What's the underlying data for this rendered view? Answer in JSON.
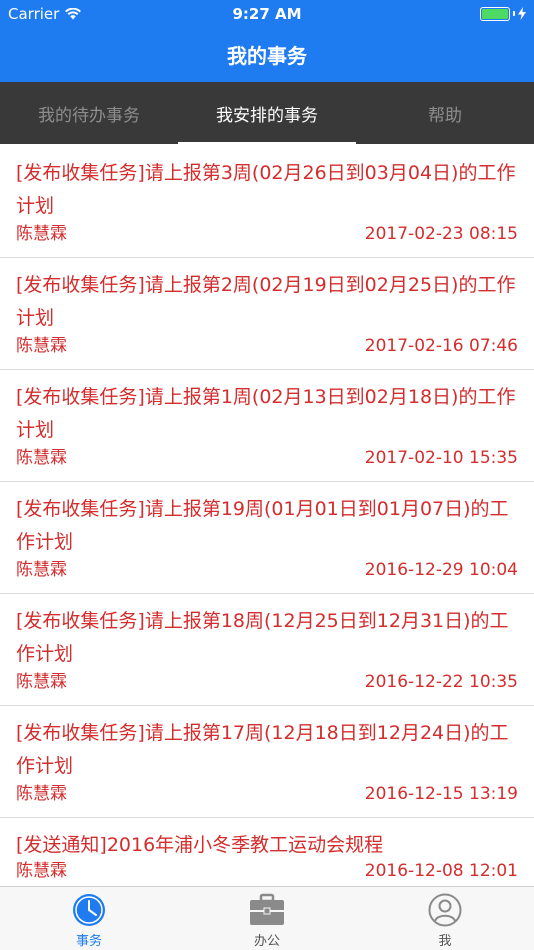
{
  "status": {
    "carrier": "Carrier",
    "time": "9:27 AM",
    "battery_level": 1.0
  },
  "header": {
    "title": "我的事务"
  },
  "tabs": [
    {
      "label": "我的待办事务",
      "active": false
    },
    {
      "label": "我安排的事务",
      "active": true
    },
    {
      "label": "帮助",
      "active": false
    }
  ],
  "items": [
    {
      "title": "[发布收集任务]请上报第3周(02月26日到03月04日)的工作计划",
      "author": "陈慧霖",
      "time": "2017-02-23 08:15"
    },
    {
      "title": "[发布收集任务]请上报第2周(02月19日到02月25日)的工作计划",
      "author": "陈慧霖",
      "time": "2017-02-16 07:46"
    },
    {
      "title": "[发布收集任务]请上报第1周(02月13日到02月18日)的工作计划",
      "author": "陈慧霖",
      "time": "2017-02-10 15:35"
    },
    {
      "title": "[发布收集任务]请上报第19周(01月01日到01月07日)的工作计划",
      "author": "陈慧霖",
      "time": "2016-12-29 10:04"
    },
    {
      "title": "[发布收集任务]请上报第18周(12月25日到12月31日)的工作计划",
      "author": "陈慧霖",
      "time": "2016-12-22 10:35"
    },
    {
      "title": "[发布收集任务]请上报第17周(12月18日到12月24日)的工作计划",
      "author": "陈慧霖",
      "time": "2016-12-15 13:19"
    },
    {
      "title": "[发送通知]2016年浦小冬季教工运动会规程",
      "author": "陈慧霖",
      "time": "2016-12-08 12:01"
    }
  ],
  "bottom_tabs": [
    {
      "label": "事务",
      "icon": "clock-icon",
      "active": true
    },
    {
      "label": "办公",
      "icon": "briefcase-icon",
      "active": false
    },
    {
      "label": "我",
      "icon": "person-icon",
      "active": false
    }
  ],
  "colors": {
    "accent": "#1e7cf0",
    "item_text": "#d42d2d",
    "tab_bg": "#393939"
  }
}
